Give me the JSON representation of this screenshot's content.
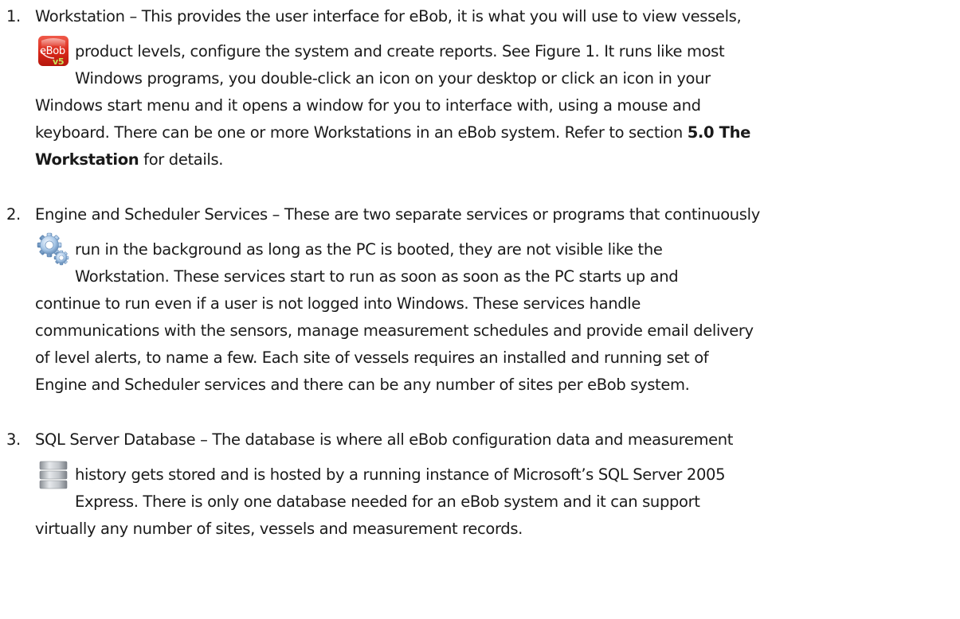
{
  "items": [
    {
      "number": "1.",
      "icon": "ebob-v5-icon",
      "lines": [
        "Workstation – This provides the user interface for eBob, it is what you will use to view vessels,",
        "product levels, configure the system and create reports.  See Figure 1.  It runs like most",
        "Windows programs, you double-click an icon on your desktop or click an icon in your",
        "Windows start menu and it opens a window for you to interface with, using a mouse and"
      ],
      "line5_text": "keyboard.  There can be one or more Workstations in an eBob system.  Refer to section ",
      "line5_bold": "5.0 The",
      "line6_bold": "Workstation",
      "line6_text": " for details."
    },
    {
      "number": "2.",
      "icon": "gears-icon",
      "lines": [
        "Engine and Scheduler Services – These are two separate services or programs that continuously",
        "run in the background as long as the PC is booted, they are not visible like the",
        "Workstation.  These services start to run as soon as soon as the PC starts up and",
        "continue to run even if a user is not logged into Windows.  These services handle",
        "communications with the sensors, manage measurement schedules and provide email delivery",
        "of level alerts, to name a few.  Each site of vessels requires an installed and running set of",
        "Engine and Scheduler services and there can be any number of sites per eBob system."
      ]
    },
    {
      "number": "3.",
      "icon": "database-icon",
      "lines": [
        "SQL Server Database – The database is where all eBob configuration data and measurement",
        "history gets stored and is hosted by a running instance of Microsoft’s SQL Server 2005",
        "Express.  There is only one database needed for an eBob system and it can support",
        "virtually any number of sites, vessels and measurement records."
      ]
    }
  ]
}
